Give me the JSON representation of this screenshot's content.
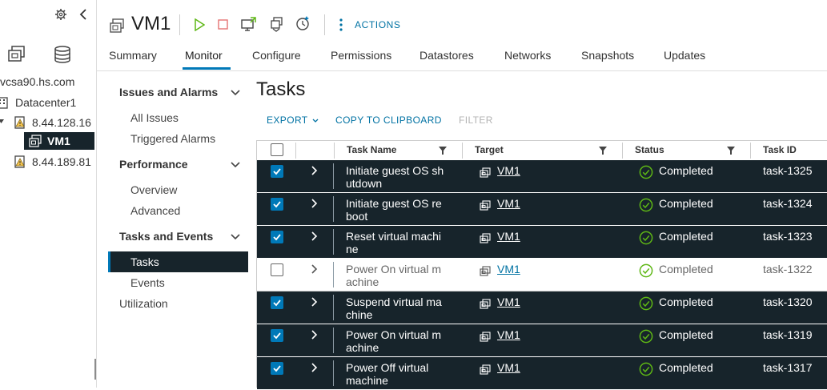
{
  "inventory": {
    "vcenter": "vcsa90.hs.com",
    "datacenter": "Datacenter1",
    "host1": "8.44.128.16",
    "vm": "VM1",
    "host2": "8.44.189.81"
  },
  "header": {
    "title": "VM1",
    "actions_label": "ACTIONS",
    "tabs": [
      "Summary",
      "Monitor",
      "Configure",
      "Permissions",
      "Datastores",
      "Networks",
      "Snapshots",
      "Updates"
    ],
    "active_tab": "Monitor"
  },
  "nav": {
    "groups": [
      {
        "label": "Issues and Alarms",
        "items": [
          "All Issues",
          "Triggered Alarms"
        ]
      },
      {
        "label": "Performance",
        "items": [
          "Overview",
          "Advanced"
        ]
      },
      {
        "label": "Tasks and Events",
        "items": [
          "Tasks",
          "Events"
        ]
      }
    ],
    "utilization": "Utilization",
    "selected": "Tasks"
  },
  "main": {
    "title": "Tasks",
    "export_label": "EXPORT",
    "copy_label": "COPY TO CLIPBOARD",
    "filter_label": "FILTER",
    "columns": [
      "Task Name",
      "Target",
      "Status",
      "Task ID"
    ],
    "rows": [
      {
        "name1": "Initiate guest OS sh",
        "name2": "utdown",
        "target": "VM1",
        "status": "Completed",
        "id": "task-1325",
        "selected": true
      },
      {
        "name1": "Initiate guest OS re",
        "name2": "boot",
        "target": "VM1",
        "status": "Completed",
        "id": "task-1324",
        "selected": true
      },
      {
        "name1": "Reset virtual machi",
        "name2": "ne",
        "target": "VM1",
        "status": "Completed",
        "id": "task-1323",
        "selected": true
      },
      {
        "name1": "Power On virtual m",
        "name2": "achine",
        "target": "VM1",
        "status": "Completed",
        "id": "task-1322",
        "selected": false
      },
      {
        "name1": "Suspend virtual ma",
        "name2": "chine",
        "target": "VM1",
        "status": "Completed",
        "id": "task-1320",
        "selected": true
      },
      {
        "name1": "Power On virtual m",
        "name2": "achine",
        "target": "VM1",
        "status": "Completed",
        "id": "task-1319",
        "selected": true
      },
      {
        "name1": "Power Off virtual",
        "name2": "machine",
        "target": "VM1",
        "status": "Completed",
        "id": "task-1317",
        "selected": true
      }
    ]
  },
  "colors": {
    "accent": "#0079b8",
    "selected_row": "#17242b",
    "status_ok": "#5eb715",
    "power_on": "#5eb715",
    "power_off": "#e57373"
  },
  "icons": [
    "gear-icon",
    "collapse-chevron-icon",
    "vms-templates-icon",
    "storage-icon",
    "vm-icon",
    "power-on-icon",
    "power-off-icon",
    "launch-console-icon",
    "migrate-icon",
    "snapshot-icon",
    "more-actions-icon",
    "checkmark-circle-icon",
    "filter-icon"
  ]
}
